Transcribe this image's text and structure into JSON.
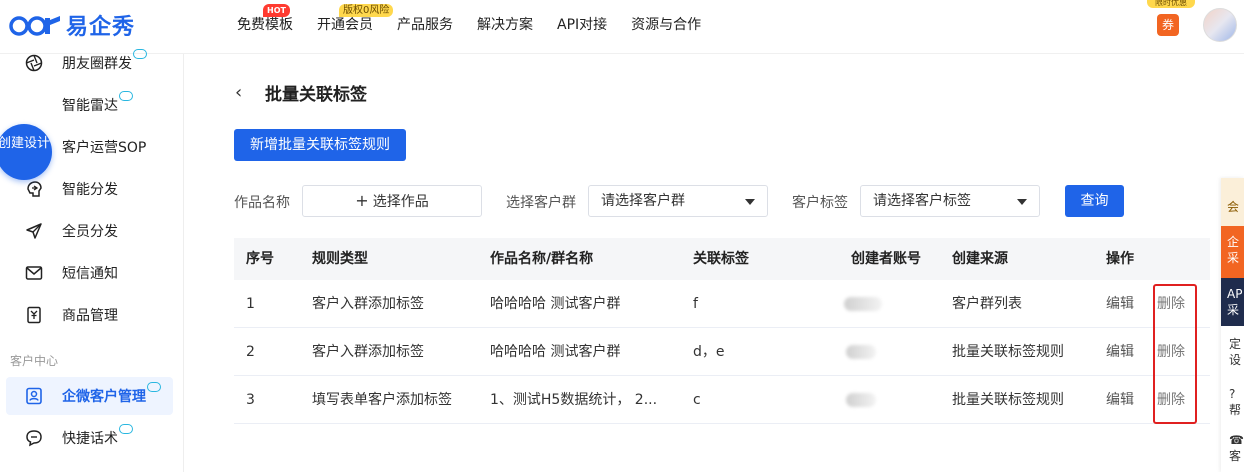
{
  "header": {
    "logo_text": "易企秀",
    "nav": [
      {
        "label": "免费模板",
        "badge": "HOT"
      },
      {
        "label": "开通会员",
        "badge": "版权0风险"
      },
      {
        "label": "产品服务",
        "badge": ""
      },
      {
        "label": "解决方案",
        "badge": ""
      },
      {
        "label": "API对接",
        "badge": ""
      },
      {
        "label": "资源与合作",
        "badge": ""
      }
    ],
    "coupon_label": "券",
    "coupon_banner": "限时优惠"
  },
  "sidebar": {
    "create_button": "创建设计",
    "items": [
      {
        "label": "朋友圈群发",
        "icon": "aperture-icon",
        "ai": true
      },
      {
        "label": "智能雷达",
        "icon": "radar-icon",
        "ai": true
      },
      {
        "label": "客户运营SOP",
        "icon": "chat-dots-icon",
        "ai": false
      },
      {
        "label": "智能分发",
        "icon": "share-brain-icon",
        "ai": false
      },
      {
        "label": "全员分发",
        "icon": "paper-plane-icon",
        "ai": false
      },
      {
        "label": "短信通知",
        "icon": "mail-icon",
        "ai": false
      },
      {
        "label": "商品管理",
        "icon": "product-icon",
        "ai": false
      }
    ],
    "group_label": "客户中心",
    "group_items": [
      {
        "label": "企微客户管理",
        "icon": "contact-card-icon",
        "ai": true,
        "active": true
      },
      {
        "label": "快捷话术",
        "icon": "quick-reply-icon",
        "ai": true,
        "active": false
      }
    ]
  },
  "page": {
    "title": "批量关联标签",
    "add_button": "新增批量关联标签规则",
    "filters": {
      "work_label": "作品名称",
      "work_button": "选择作品",
      "group_label": "选择客户群",
      "group_placeholder": "请选择客户群",
      "tag_label": "客户标签",
      "tag_placeholder": "请选择客户标签",
      "query_button": "查询"
    }
  },
  "table": {
    "headers": [
      "序号",
      "规则类型",
      "作品名称/群名称",
      "关联标签",
      "创建者账号",
      "创建来源",
      "操作"
    ],
    "rows": [
      {
        "index": "1",
        "type": "客户入群添加标签",
        "name": "哈哈哈哈 测试客户群",
        "tags": "f",
        "creator": "",
        "source": "客户群列表",
        "edit": "编辑",
        "delete": "删除"
      },
      {
        "index": "2",
        "type": "客户入群添加标签",
        "name": "哈哈哈哈 测试客户群",
        "tags": "d，e",
        "creator": "",
        "source": "批量关联标签规则",
        "edit": "编辑",
        "delete": "删除"
      },
      {
        "index": "3",
        "type": "填写表单客户添加标签",
        "name": "1、测试H5数据统计，  2...",
        "tags": "c",
        "creator": "",
        "source": "批量关联标签规则",
        "edit": "编辑",
        "delete": "删除"
      }
    ]
  },
  "right_panel": {
    "items": [
      "会",
      "企",
      "采",
      "AP",
      "采",
      "定",
      "设",
      "帮",
      "客"
    ]
  },
  "colors": {
    "primary": "#1f64e8",
    "highlight_border": "#e02020",
    "hot": "#ff3b30",
    "coupon": "#f26522"
  }
}
